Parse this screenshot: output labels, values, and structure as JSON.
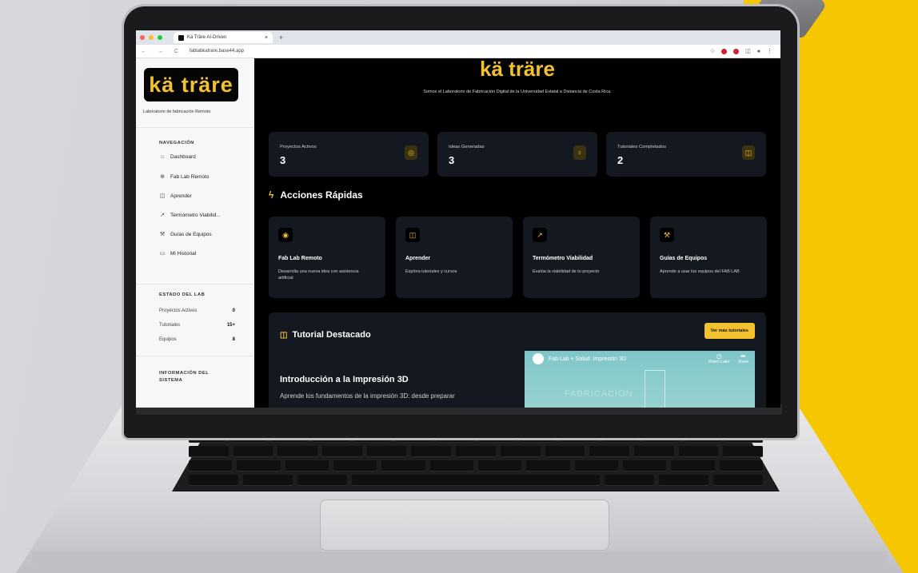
{
  "browser": {
    "tab_title": "Kä Träre AI-Driven",
    "tab_close": "×",
    "new_tab": "+",
    "nav_icons": "← → C",
    "url": "fablabkatrare.base44.app"
  },
  "sidebar": {
    "logo": "kä träre",
    "subtitle": "Laboratorio de fabricación Remoto",
    "nav_heading": "NAVEGACIÓN",
    "nav_items": [
      {
        "label": "Dashboard",
        "icon": "home-icon"
      },
      {
        "label": "Fab Lab Remoto",
        "icon": "cpu-icon"
      },
      {
        "label": "Aprender",
        "icon": "book-icon"
      },
      {
        "label": "Termómetro Viabilid...",
        "icon": "trend-icon"
      },
      {
        "label": "Guías de Equipos",
        "icon": "wrench-icon"
      },
      {
        "label": "Mi Historial",
        "icon": "folder-icon"
      }
    ],
    "lab_heading": "ESTADO DEL LAB",
    "lab_stats": [
      {
        "label": "Proyectos Activos",
        "value": "0"
      },
      {
        "label": "Tutoriales",
        "value": "15+"
      },
      {
        "label": "Equipos",
        "value": "8"
      }
    ],
    "info_heading": "INFORMACIÓN DEL SISTEMA"
  },
  "main": {
    "brand": "kä träre",
    "tagline": "Somos el Laboratorio de Fabricación Digital de la Universidad Estatal a Distancia de Costa Rica.",
    "stats": [
      {
        "label": "Proyectos Activos",
        "value": "3",
        "icon": "target-icon"
      },
      {
        "label": "Ideas Generadas",
        "value": "3",
        "icon": "lightbulb-icon"
      },
      {
        "label": "Tutoriales Completados",
        "value": "2",
        "icon": "book-icon"
      }
    ],
    "quick_actions_title": "Acciones Rápidas",
    "quick_actions": [
      {
        "title": "Fab Lab Remoto",
        "desc": "Desarrolla una nueva idea con asistencia artificial",
        "icon": "bulb-icon"
      },
      {
        "title": "Aprender",
        "desc": "Explora tutoriales y cursos",
        "icon": "book-icon"
      },
      {
        "title": "Termómetro Viabilidad",
        "desc": "Evalúa la viabilidad de tu proyecto",
        "icon": "trend-icon"
      },
      {
        "title": "Guías de Equipos",
        "desc": "Aprende a usar los equipos del FAB LAB",
        "icon": "wrench-icon"
      }
    ],
    "featured": {
      "heading": "Tutorial Destacado",
      "button": "Ver más tutoriales",
      "title": "Introducción a la Impresión 3D",
      "desc": "Aprende los fundamentos de la impresión 3D: desde preparar",
      "video_title": "Fab Lab + Salud: Impresión 3D",
      "video_watch_later": "Watch Later",
      "video_share": "Share",
      "video_watermark": "FABRICACIÓN"
    }
  },
  "colors": {
    "accent": "#f2c12e",
    "card": "#141820"
  }
}
